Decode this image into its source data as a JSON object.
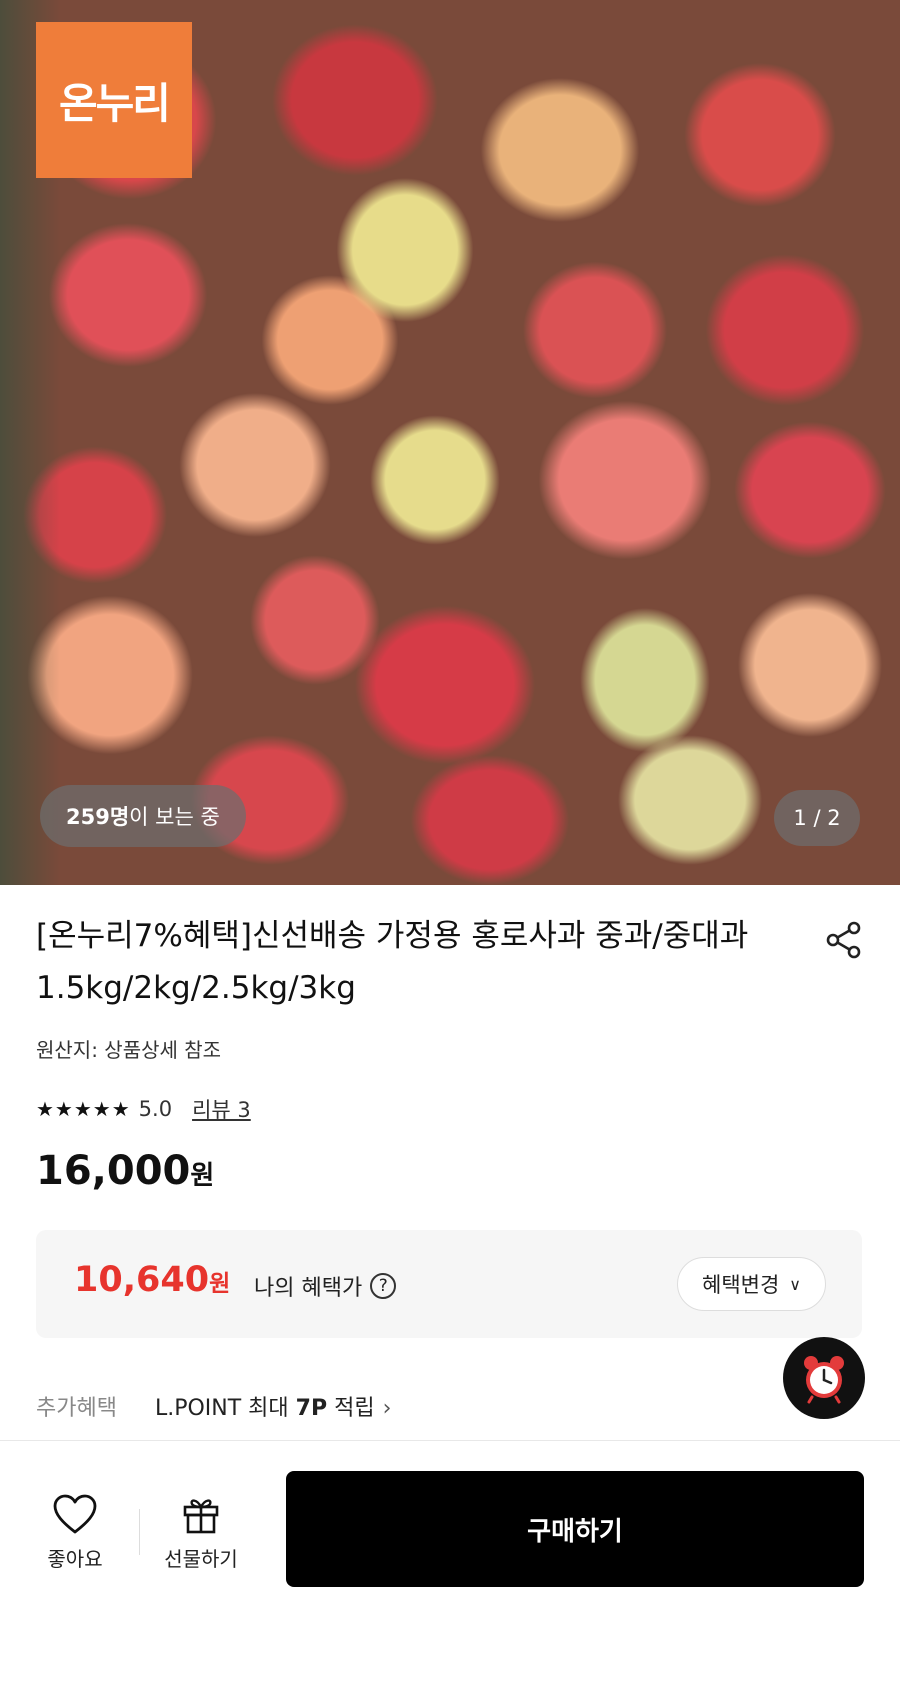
{
  "hero": {
    "badge_text": "온누리",
    "viewers_count": "259명",
    "viewers_suffix": "이 보는 중",
    "page_counter": "1 / 2"
  },
  "product": {
    "title": "[온누리7%혜택]신선배송 가정용 홍로사과 중과/중대과 1.5kg/2kg/2.5kg/3kg",
    "origin": "원산지: 상품상세 참조",
    "rating_stars": "★★★★★",
    "rating_score": "5.0",
    "review_link": "리뷰 3",
    "price_value": "16,000",
    "price_unit": "원"
  },
  "benefit": {
    "price_value": "10,640",
    "price_unit": "원",
    "label": "나의 혜택가",
    "help_icon": "?",
    "change_button": "혜택변경",
    "change_chevron": "∨"
  },
  "extra": {
    "label": "추가혜택",
    "value_prefix": "L.POINT 최대 ",
    "value_bold": "7P",
    "value_suffix": " 적립",
    "chevron": "›"
  },
  "bottom_bar": {
    "like_label": "좋아요",
    "gift_label": "선물하기",
    "buy_label": "구매하기"
  },
  "icons": {
    "share": "share-icon",
    "heart": "heart-icon",
    "gift": "gift-icon",
    "alarm": "alarm-clock-icon"
  },
  "colors": {
    "accent_red": "#e7342d",
    "onnuri_orange": "#ef7d3a",
    "buy_button": "#000000"
  }
}
